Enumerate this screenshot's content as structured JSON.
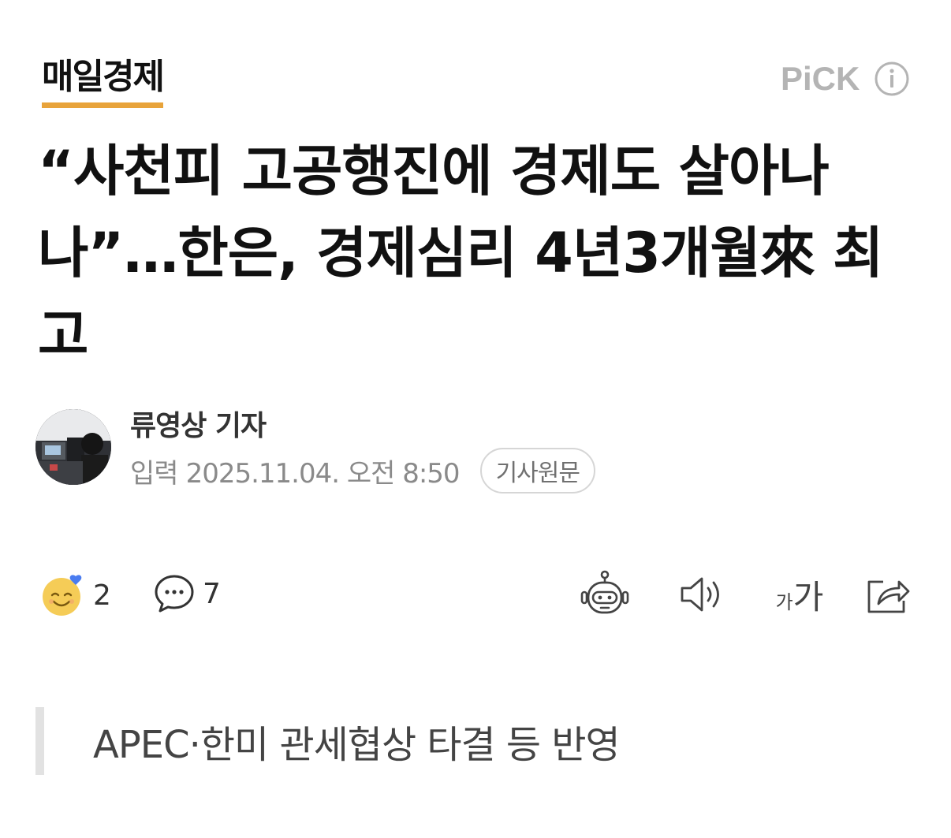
{
  "header": {
    "logo_text": "매일경제",
    "pick_label": "PiCK",
    "info_icon": "info-circle-icon"
  },
  "article": {
    "headline": "“사천피 고공행진에 경제도 살아나나”…한은, 경제심리 4년3개월來 최고",
    "reporter": "류영상 기자",
    "date_label": "입력",
    "date_value": "2025.11.04. 오전 8:50",
    "original_button": "기사원문",
    "subheading": "APEC·한미 관세협상 타결 등 반영"
  },
  "actions": {
    "reaction_count": "2",
    "comment_count": "7",
    "font_small": "가",
    "font_large": "가",
    "icons": [
      "smiley-reaction-icon",
      "comment-bubble-icon",
      "robot-summary-icon",
      "speaker-icon",
      "font-size-icon",
      "share-icon"
    ]
  },
  "colors": {
    "logo_underline": "#e8a33a",
    "pick_gray": "#b4b4b4",
    "subhead_bar": "#e2e2e2",
    "reaction_yellow": "#f5cc57",
    "heart_blue": "#4a7cf0"
  }
}
